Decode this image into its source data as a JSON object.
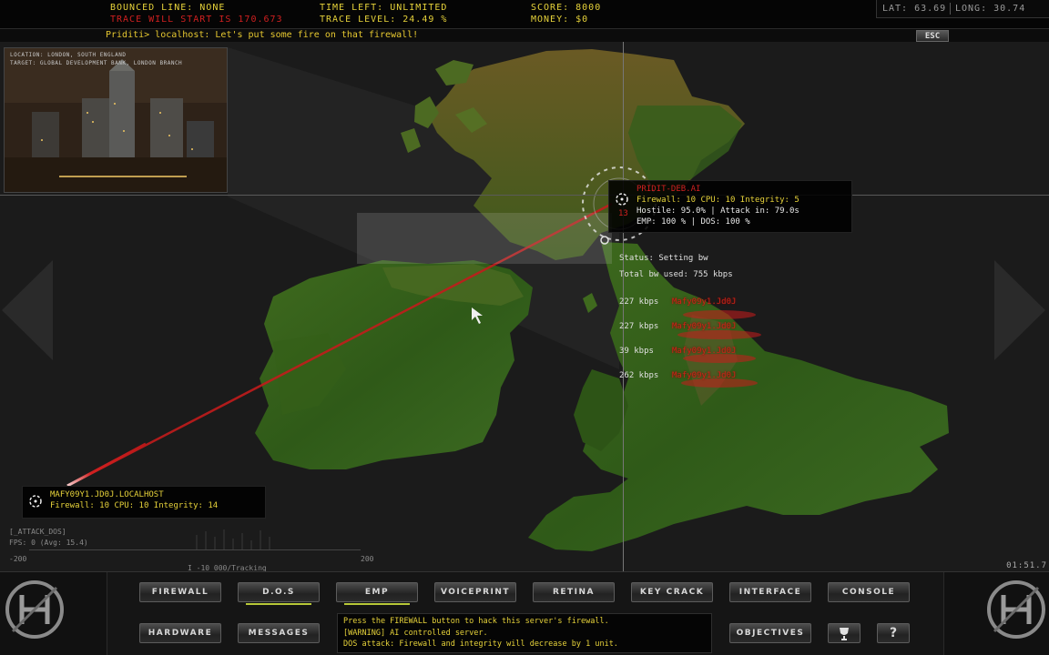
{
  "hud": {
    "bounced_line": "BOUNCED LINE: NONE",
    "trace_start": "TRACE WILL START IS 170.673",
    "time_left": "TIME LEFT: UNLIMITED",
    "trace_level": "TRACE LEVEL: 24.49 %",
    "score": "SCORE: 8000",
    "money": "MONEY: $0",
    "lat": "LAT: 63.69",
    "long": "LONG: 30.74",
    "message": "Priditi> localhost: Let's put some fire on that firewall!",
    "esc_label": "ESC"
  },
  "camera": {
    "location": "LOCATION: LONDON, SOUTH ENGLAND",
    "target": "TARGET: GLOBAL DEVELOPMENT BANK, LONDON BRANCH"
  },
  "target_node": {
    "title": "PRIDIT-DEB.AI",
    "firewall": "Firewall: 10 CPU: 10 Integrity: 5",
    "hostile": "Hostile: 95.0% | Attack in: 79.0s",
    "emp": "EMP: 100 % | DOS: 100 %",
    "side_marker": "13"
  },
  "dos_stats": {
    "status": "Status: Setting bw",
    "total_bw": "Total bw used:  755 kbps",
    "rows": [
      {
        "bw": "227 kbps",
        "target": "Mafy09y1.Jd0J"
      },
      {
        "bw": "227 kbps",
        "target": "Mafy09y1.Jd0J"
      },
      {
        "bw": "39 kbps",
        "target": "Mafy09y1.Jd0J"
      },
      {
        "bw": "262 kbps",
        "target": "Mafy09y1.Jd0J"
      }
    ]
  },
  "local_node": {
    "title": "MAFY09Y1.JD0J.LOCALHOST",
    "firewall": "Firewall: 10 CPU: 10 Integrity: 14"
  },
  "graph": {
    "title": "[_ATTACK_DOS]",
    "fps": "FPS:   0 (Avg: 15.4)",
    "left_tick": "-200",
    "right_tick": "200",
    "center_label": "I -10 000/Tracking"
  },
  "clock": "01:51.7",
  "buttons": {
    "firewall": "FIREWALL",
    "dos": "D.O.S",
    "emp": "EMP",
    "voiceprint": "VOICEPRINT",
    "retina": "RETINA",
    "key_crack": "KEY CRACK",
    "interface": "INTERFACE",
    "console": "CONSOLE",
    "hardware": "HARDWARE",
    "messages": "MESSAGES",
    "objectives": "OBJECTIVES",
    "help": "?"
  },
  "help_text": {
    "line1": "Press the FIREWALL button to hack this server's firewall.",
    "line2": "[WARNING] AI controlled server.",
    "line3": "DOS attack: Firewall and integrity will decrease by 1 unit."
  },
  "icons": [
    "trophy-icon",
    "crosshair-icon",
    "cursor-icon",
    "logo-icon",
    "left-arrow-icon",
    "right-arrow-icon"
  ]
}
